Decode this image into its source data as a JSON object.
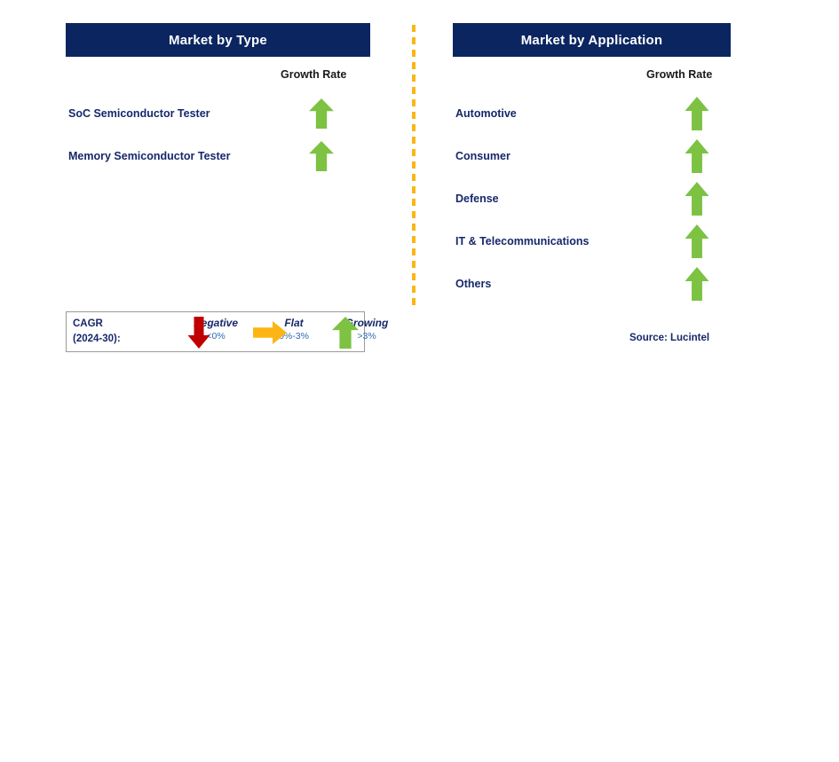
{
  "colors": {
    "header_bg": "#0a2560",
    "header_text": "#ffffff",
    "label_navy": "#16286b",
    "growth_green": "#7dc242",
    "negative_red": "#c00000",
    "flat_orange": "#fcb514",
    "range_blue": "#2f6bb0",
    "divider_orange": "#fcb514",
    "legend_border": "#9a9a9a",
    "page_bg": "#ffffff"
  },
  "type_panel": {
    "header": "Market by Type",
    "growth_rate_label": "Growth Rate",
    "rows": [
      {
        "label": "SoC Semiconductor Tester",
        "trend": "growing",
        "icon": "arrow-up-icon"
      },
      {
        "label": "Memory Semiconductor Tester",
        "trend": "growing",
        "icon": "arrow-up-icon"
      }
    ]
  },
  "application_panel": {
    "header": "Market by Application",
    "growth_rate_label": "Growth Rate",
    "rows": [
      {
        "label": "Automotive",
        "trend": "growing",
        "icon": "arrow-up-icon"
      },
      {
        "label": "Consumer",
        "trend": "growing",
        "icon": "arrow-up-icon"
      },
      {
        "label": "Defense",
        "trend": "growing",
        "icon": "arrow-up-icon"
      },
      {
        "label": "IT & Telecommunications",
        "trend": "growing",
        "icon": "arrow-up-icon"
      },
      {
        "label": "Others",
        "trend": "growing",
        "icon": "arrow-up-icon"
      }
    ]
  },
  "legend": {
    "title_line1": "CAGR",
    "title_line2": "(2024-30):",
    "items": [
      {
        "term": "Negative",
        "range": "<0%",
        "icon": "arrow-down-icon",
        "color": "#c00000"
      },
      {
        "term": "Flat",
        "range": "0%-3%",
        "icon": "arrow-right-icon",
        "color": "#fcb514"
      },
      {
        "term": "Growing",
        "range": ">3%",
        "icon": "arrow-up-icon",
        "color": "#7dc242"
      }
    ]
  },
  "source": "Source: Lucintel"
}
